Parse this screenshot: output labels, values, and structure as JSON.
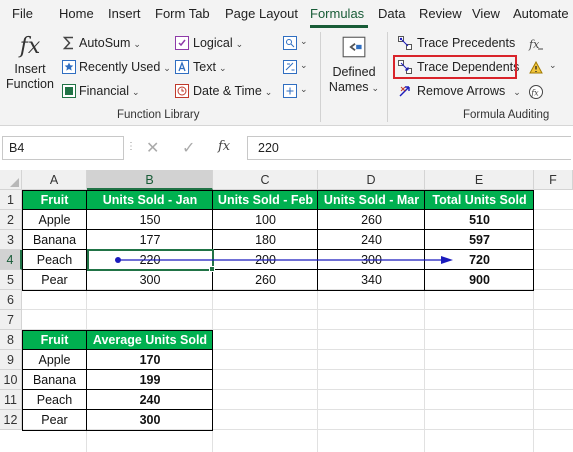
{
  "tabs": [
    {
      "label": "File"
    },
    {
      "label": "Home"
    },
    {
      "label": "Insert"
    },
    {
      "label": "Form Tab"
    },
    {
      "label": "Page Layout"
    },
    {
      "label": "Formulas"
    },
    {
      "label": "Data"
    },
    {
      "label": "Review"
    },
    {
      "label": "View"
    },
    {
      "label": "Automate"
    }
  ],
  "active_tab": "Formulas",
  "ribbon": {
    "insert_function": {
      "line1": "Insert",
      "line2": "Function",
      "icon": "fx-icon"
    },
    "library": {
      "autosum": "AutoSum",
      "recently_used": "Recently Used",
      "financial": "Financial",
      "logical": "Logical",
      "text": "Text",
      "date_time": "Date & Time",
      "group_label": "Function Library"
    },
    "defined_names": {
      "line1": "Defined",
      "line2": "Names"
    },
    "auditing": {
      "trace_precedents": "Trace Precedents",
      "trace_dependents": "Trace Dependents",
      "remove_arrows": "Remove Arrows",
      "group_label": "Formula Auditing"
    },
    "highlight_color": "#d9232a"
  },
  "formula_bar": {
    "name_box": "B4",
    "fx": "fx",
    "value": "220"
  },
  "grid": {
    "columns": [
      "A",
      "B",
      "C",
      "D",
      "E",
      "F"
    ],
    "rows": [
      "1",
      "2",
      "3",
      "4",
      "5",
      "6",
      "7",
      "8",
      "9",
      "10",
      "11",
      "12"
    ],
    "selected_cell": "B4",
    "header_fill": "#00b050",
    "table1": {
      "headers": [
        "Fruit",
        "Units Sold - Jan",
        "Units Sold - Feb",
        "Units Sold - Mar",
        "Total Units Sold"
      ],
      "rows": [
        [
          "Apple",
          "150",
          "100",
          "260",
          "510"
        ],
        [
          "Banana",
          "177",
          "180",
          "240",
          "597"
        ],
        [
          "Peach",
          "220",
          "200",
          "300",
          "720"
        ],
        [
          "Pear",
          "300",
          "260",
          "340",
          "900"
        ]
      ]
    },
    "table2": {
      "headers": [
        "Fruit",
        "Average Units Sold"
      ],
      "rows": [
        [
          "Apple",
          "170"
        ],
        [
          "Banana",
          "199"
        ],
        [
          "Peach",
          "240"
        ],
        [
          "Pear",
          "300"
        ]
      ]
    },
    "trace_arrow_color": "#1b1bbd"
  }
}
